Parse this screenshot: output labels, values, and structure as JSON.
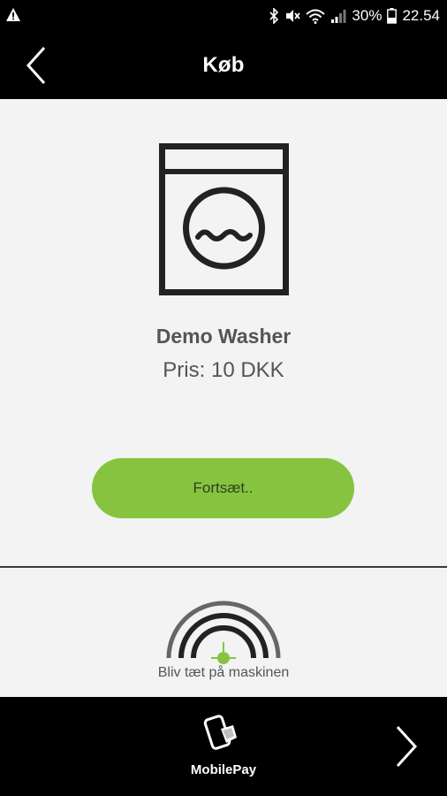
{
  "status_bar": {
    "battery": "30%",
    "time": "22.54",
    "icons": [
      "warning-icon",
      "bluetooth-icon",
      "mute-icon",
      "wifi-icon",
      "signal-icon",
      "battery-icon"
    ]
  },
  "header": {
    "title": "Køb",
    "back_icon": "chevron-left-icon"
  },
  "machine": {
    "icon": "washing-machine-icon",
    "name": "Demo Washer",
    "price": "Pris: 10 DKK"
  },
  "continue_button": {
    "label": "Fortsæt..",
    "color": "#86c440"
  },
  "proximity": {
    "icon": "proximity-signal-icon",
    "label": "Bliv tæt på maskinen",
    "accent": "#86c440"
  },
  "footer": {
    "logo_icon": "mobilepay-logo-icon",
    "label": "MobilePay",
    "next_icon": "chevron-right-icon"
  }
}
